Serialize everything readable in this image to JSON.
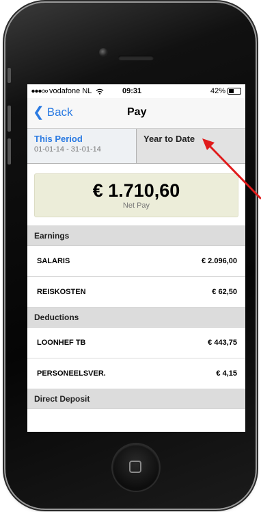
{
  "status": {
    "carrier": "vodafone NL",
    "time": "09:31",
    "battery_percent": "42%",
    "battery_level": 0.42,
    "signal_icon": "signal-dots-icon",
    "wifi_icon": "wifi-icon"
  },
  "navbar": {
    "back_label": "Back",
    "title": "Pay"
  },
  "tabs": [
    {
      "label": "This Period",
      "sublabel": "01-01-14 - 31-01-14",
      "selected": true
    },
    {
      "label": "Year to Date",
      "sublabel": "",
      "selected": false
    }
  ],
  "net_pay": {
    "amount": "€ 1.710,60",
    "label": "Net Pay"
  },
  "sections": {
    "earnings": {
      "title": "Earnings",
      "rows": [
        {
          "label": "SALARIS",
          "value": "€ 2.096,00"
        },
        {
          "label": "REISKOSTEN",
          "value": "€ 62,50"
        }
      ]
    },
    "deductions": {
      "title": "Deductions",
      "rows": [
        {
          "label": "LOONHEF TB",
          "value": "€ 443,75"
        },
        {
          "label": "PERSONEELSVER.",
          "value": "€ 4,15"
        }
      ]
    },
    "direct_deposit": {
      "title": "Direct Deposit"
    }
  },
  "colors": {
    "accent": "#2a7ae2",
    "net_pay_background": "#ecedd9",
    "annotation_arrow": "#e01b1b"
  }
}
